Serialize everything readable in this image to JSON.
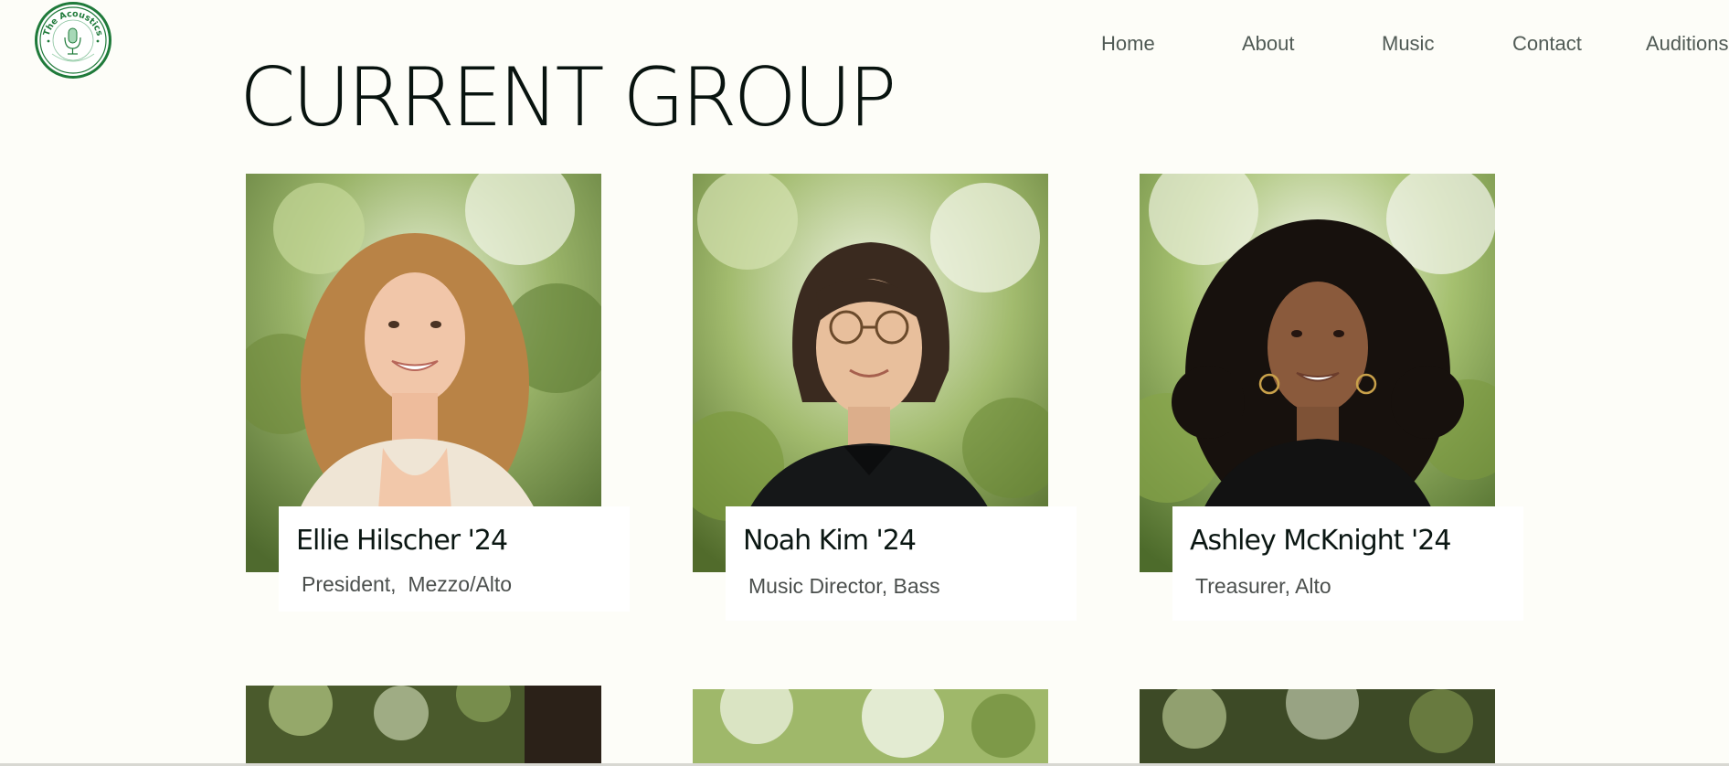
{
  "logo": {
    "text": "The Acoustics",
    "accent": "#1f7a3a"
  },
  "nav": {
    "items": [
      "Home",
      "About",
      "Music",
      "Contact",
      "Auditions"
    ]
  },
  "page": {
    "title": "CURRENT GROUP"
  },
  "members": [
    {
      "name": "Ellie Hilscher '24",
      "role": "President,  Mezzo/Alto"
    },
    {
      "name": "Noah Kim '24",
      "role": "Music Director, Bass"
    },
    {
      "name": "Ashley McKnight '24",
      "role": "Treasurer, Alto"
    }
  ],
  "colors": {
    "background": "#fdfdf8",
    "title": "#08130f",
    "nav_text": "#505a55",
    "caption_bg": "#ffffff"
  }
}
